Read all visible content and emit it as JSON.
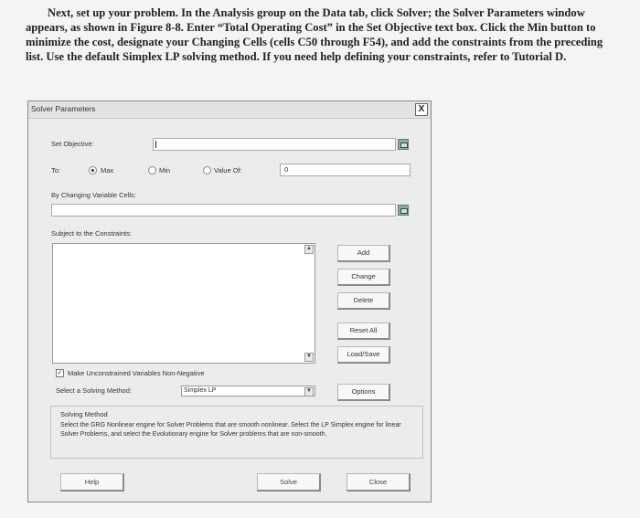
{
  "instructions": "Next, set up your problem. In the Analysis group on the Data tab, click Solver; the Solver Parameters window appears, as shown in Figure 8-8. Enter “Total Operating Cost” in the Set Objective text box. Click the Min button to minimize the cost, designate your Changing Cells (cells C50 through F54), and add the constraints from the preceding list. Use the default Simplex LP solving method. If you need help defining your constraints, refer to Tutorial D.",
  "dialog": {
    "title": "Solver Parameters",
    "close_label": "X",
    "set_objective_label": "Set Objective:",
    "set_objective_value": "",
    "to_label": "To:",
    "max_label": "Max",
    "min_label": "Min",
    "value_of_label": "Value Of:",
    "value_of_value": "0",
    "changing_cells_label": "By Changing Variable Cells:",
    "changing_cells_value": "",
    "constraints_label": "Subject to the Constraints:",
    "buttons": {
      "add": "Add",
      "change": "Change",
      "delete": "Delete",
      "reset_all": "Reset All",
      "load_save": "Load/Save",
      "options": "Options"
    },
    "nonneg_label": "Make Unconstrained Variables Non-Negative",
    "nonneg_checked_mark": "✓",
    "solving_method_label": "Select a Solving Method:",
    "solving_method_value": "Simplex LP",
    "group_title": "Solving Method",
    "group_description": "Select the GRG Nonlinear engine for Solver Problems that are smooth nonlinear. Select the LP Simplex engine for linear Solver Problems, and select the Evolutionary engine for Solver problems that are non-smooth.",
    "help_label": "Help",
    "solve_label": "Solve",
    "close_button_label": "Close"
  }
}
